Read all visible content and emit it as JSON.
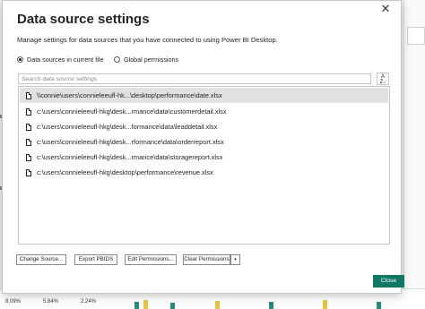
{
  "dialog": {
    "title": "Data source settings",
    "close_glyph": "✕",
    "description": "Manage settings for data sources that you have connected to using Power BI Desktop.",
    "scope": {
      "options": [
        {
          "label": "Data sources in current file",
          "checked": true
        },
        {
          "label": "Global permissions",
          "checked": false
        }
      ]
    },
    "search": {
      "placeholder": "Search data source settings"
    },
    "sort_icon": "sort-az-icon",
    "sources": [
      {
        "path": "\\\\connie\\users\\connieleeufl-hk...\\desktop\\performance\\date.xlsx",
        "selected": true
      },
      {
        "path": "c:\\users\\connieleeufl-hkg\\desk...rmance\\data\\customerdetail.xlsx",
        "selected": false
      },
      {
        "path": "c:\\users\\connieleeufl-hkg\\desk...formance\\data\\leaddetail.xlsx",
        "selected": false
      },
      {
        "path": "c:\\users\\connieleeufl-hkg\\desk...rformance\\data\\orderreport.xlsx",
        "selected": false
      },
      {
        "path": "c:\\users\\connieleeufl-hkg\\desk...rmance\\data\\storagereport.xlsx",
        "selected": false
      },
      {
        "path": "c:\\users\\connieleeufl-hkg\\desktop\\performance\\revenue.xlsx",
        "selected": false
      }
    ],
    "buttons": {
      "change_source": "Change Source...",
      "export_pbids": "Export PBIDS",
      "edit_permissions": "Edit Permissions...",
      "clear_permissions": "Clear Permissions",
      "clear_dropdown": "▾",
      "close": "Close"
    },
    "accent_color": "#117865"
  },
  "background": {
    "bottom_values": [
      "8.09%",
      "5.84%",
      "2.24%"
    ]
  }
}
